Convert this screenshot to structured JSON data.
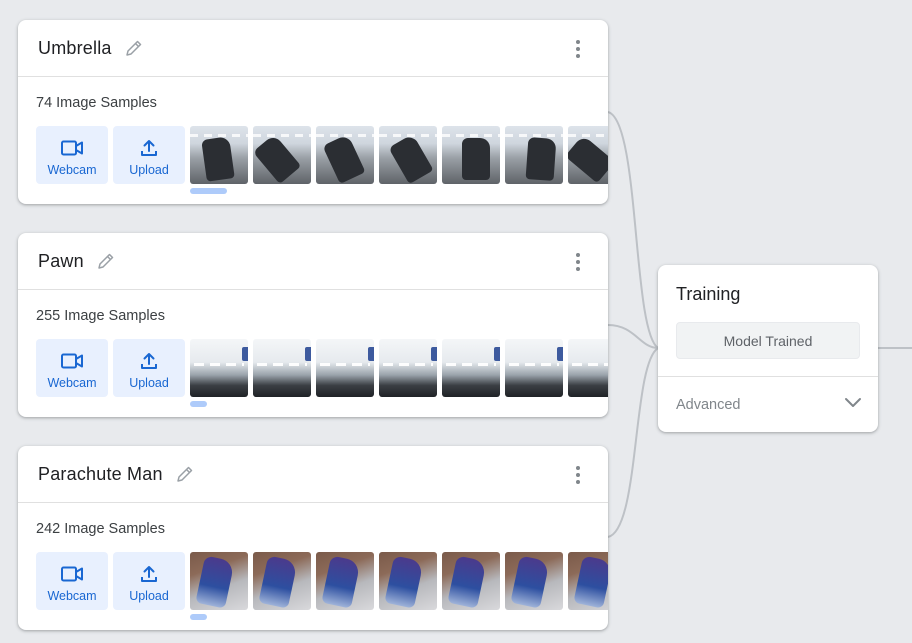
{
  "classes": [
    {
      "name": "Umbrella",
      "sample_count": "74 Image Samples",
      "webcam_label": "Webcam",
      "upload_label": "Upload",
      "thumbnail_style": "umbrella"
    },
    {
      "name": "Pawn",
      "sample_count": "255 Image Samples",
      "webcam_label": "Webcam",
      "upload_label": "Upload",
      "thumbnail_style": "pawn"
    },
    {
      "name": "Parachute Man",
      "sample_count": "242 Image Samples",
      "webcam_label": "Webcam",
      "upload_label": "Upload",
      "thumbnail_style": "parachute"
    }
  ],
  "training": {
    "title": "Training",
    "status_button": "Model Trained",
    "advanced_label": "Advanced"
  },
  "icons": {
    "edit": "pencil-icon",
    "menu": "more-vert-icon",
    "webcam": "videocam-icon",
    "upload": "upload-icon",
    "advanced": "chevron-down-icon"
  },
  "colors": {
    "background": "#e8eaed",
    "card": "#ffffff",
    "accent": "#1967d2",
    "button_tint": "#e8f0fe",
    "scroll_pill": "#aecbfa",
    "muted_text": "#80868b"
  }
}
